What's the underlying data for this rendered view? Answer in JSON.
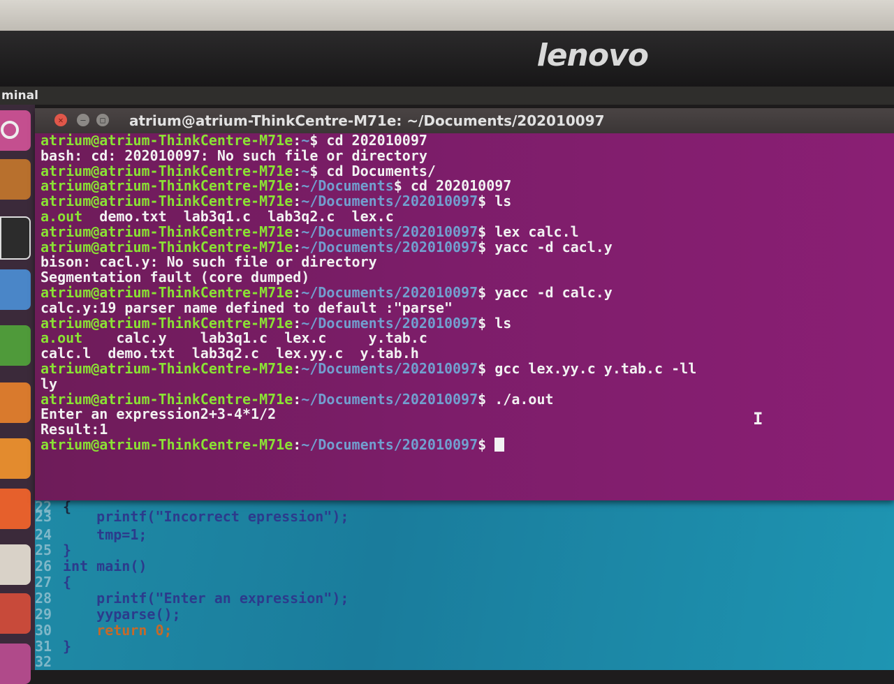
{
  "monitor": {
    "brand": "lenovo"
  },
  "panel": {
    "title": "minal"
  },
  "launcher": {
    "icons": [
      "ubuntu-dash-icon",
      "files-icon",
      "terminal-icon",
      "writer-icon",
      "calc-icon",
      "impress-icon",
      "software-icon",
      "firefox-icon",
      "amazon-icon",
      "settings-icon"
    ]
  },
  "terminal": {
    "title": "atrium@atrium-ThinkCentre-M71e: ~/Documents/202010097",
    "prompt_user": "atrium@atrium-ThinkCentre-M71e",
    "lines": [
      {
        "kind": "prompt",
        "path": "~",
        "cmd": " cd 202010097"
      },
      {
        "kind": "out",
        "text": "bash: cd: 202010097: No such file or directory"
      },
      {
        "kind": "prompt",
        "path": "~",
        "cmd": " cd Documents/"
      },
      {
        "kind": "prompt",
        "path": "~/Documents",
        "cmd": " cd 202010097"
      },
      {
        "kind": "prompt",
        "path": "~/Documents/202010097",
        "cmd": " ls"
      },
      {
        "kind": "ls",
        "text": "a.out  demo.txt  lab3q1.c  lab3q2.c  lex.c"
      },
      {
        "kind": "prompt",
        "path": "~/Documents/202010097",
        "cmd": " lex calc.l"
      },
      {
        "kind": "prompt",
        "path": "~/Documents/202010097",
        "cmd": " yacc -d cacl.y"
      },
      {
        "kind": "out",
        "text": "bison: cacl.y: No such file or directory"
      },
      {
        "kind": "out",
        "text": "Segmentation fault (core dumped)"
      },
      {
        "kind": "prompt",
        "path": "~/Documents/202010097",
        "cmd": " yacc -d calc.y"
      },
      {
        "kind": "out",
        "text": "calc.y:19 parser name defined to default :\"parse\""
      },
      {
        "kind": "prompt",
        "path": "~/Documents/202010097",
        "cmd": " ls"
      },
      {
        "kind": "ls",
        "text": "a.out    calc.y    lab3q1.c  lex.c     y.tab.c"
      },
      {
        "kind": "out",
        "text": "calc.l  demo.txt  lab3q2.c  lex.yy.c  y.tab.h"
      },
      {
        "kind": "prompt",
        "path": "~/Documents/202010097",
        "cmd": " gcc lex.yy.c y.tab.c -ll"
      },
      {
        "kind": "out",
        "text": "ly"
      },
      {
        "kind": "prompt",
        "path": "~/Documents/202010097",
        "cmd": " ./a.out"
      },
      {
        "kind": "out",
        "text": "Enter an expression2+3-4*1/2"
      },
      {
        "kind": "out",
        "text": "Result:1"
      },
      {
        "kind": "prompt",
        "path": "~/Documents/202010097",
        "cmd": " "
      }
    ]
  },
  "editor": {
    "lines": [
      {
        "n": "22",
        "code": "{"
      },
      {
        "n": "23",
        "code": "    printf(\"Incorrect epression\");"
      },
      {
        "n": "24",
        "code": "    tmp=1;"
      },
      {
        "n": "25",
        "code": "}"
      },
      {
        "n": "26",
        "code": "int main()"
      },
      {
        "n": "27",
        "code": "{"
      },
      {
        "n": "28",
        "code": "    printf(\"Enter an expression\");"
      },
      {
        "n": "29",
        "code": "    yyparse();"
      },
      {
        "n": "30",
        "code": "    return 0;"
      },
      {
        "n": "31",
        "code": "}"
      },
      {
        "n": "32",
        "code": ""
      }
    ]
  },
  "colors": {
    "terminal_bg": "#7c1d69",
    "prompt_user": "#8ae234",
    "prompt_path": "#729fcf",
    "editor_bg": "#1a7c9c"
  }
}
